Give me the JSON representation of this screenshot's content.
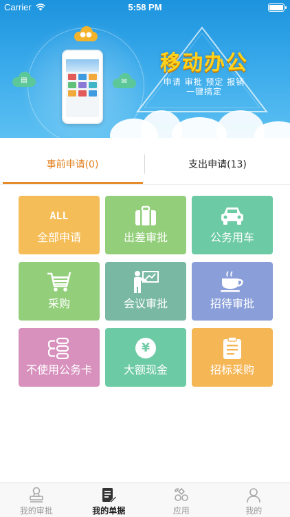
{
  "status_bar": {
    "carrier": "Carrier",
    "time": "5:58 PM"
  },
  "banner": {
    "title": "移动办公",
    "subtitle_line1": "申请 审批 预定 报销",
    "subtitle_line2": "一键搞定"
  },
  "tabs": [
    {
      "label": "事前申请(0)",
      "active": true
    },
    {
      "label": "支出申请(13)",
      "active": false
    }
  ],
  "grid": [
    {
      "label": "全部申请",
      "icon": "all-icon",
      "icon_text": "ALL",
      "color": "#f5bd57"
    },
    {
      "label": "出差审批",
      "icon": "briefcase-icon",
      "color": "#93cf7b"
    },
    {
      "label": "公务用车",
      "icon": "car-icon",
      "color": "#6ccaa4"
    },
    {
      "label": "采购",
      "icon": "shopping-cart-icon",
      "color": "#93cf7b"
    },
    {
      "label": "会议审批",
      "icon": "presentation-icon",
      "color": "#79b8a3"
    },
    {
      "label": "招待审批",
      "icon": "coffee-cup-icon",
      "color": "#8a9fd9"
    },
    {
      "label": "不使用公务卡",
      "icon": "flow-icon",
      "color": "#d890bd"
    },
    {
      "label": "大额现金",
      "icon": "yuan-coin-icon",
      "icon_text": "¥",
      "color": "#6ccaa4"
    },
    {
      "label": "招标采购",
      "icon": "clipboard-icon",
      "color": "#f5b656"
    }
  ],
  "bottom_nav": [
    {
      "label": "我的审批",
      "icon": "stamp-icon",
      "active": false
    },
    {
      "label": "我的单据",
      "icon": "document-edit-icon",
      "active": true
    },
    {
      "label": "应用",
      "icon": "apps-icon",
      "active": false
    },
    {
      "label": "我的",
      "icon": "user-icon",
      "active": false
    }
  ],
  "colors": {
    "accent": "#e78a2a",
    "banner": "#2a9fe4"
  }
}
